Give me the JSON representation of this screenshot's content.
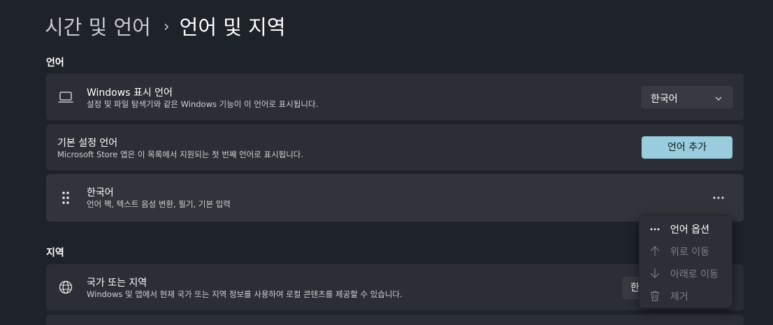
{
  "breadcrumb": {
    "parent": "시간 및 언어",
    "separator": "›",
    "current": "언어 및 지역"
  },
  "sections": {
    "language": "언어",
    "region": "지역"
  },
  "display_language": {
    "icon": "laptop-icon",
    "title": "Windows 표시 언어",
    "subtitle": "설정 및 파일 탐색기와 같은 Windows 기능이 이 언어로 표시됩니다.",
    "dropdown_value": "한국어"
  },
  "preferred_languages": {
    "title": "기본 설정 언어",
    "subtitle": "Microsoft Store 앱은 이 목록에서 지원되는 첫 번째 언어로 표시됩니다.",
    "add_button": "언어 추가"
  },
  "language_item": {
    "icon": "drag-handle-icon",
    "title": "한국어",
    "subtitle": "언어 팩, 텍스트 음성 변환, 필기, 기본 입력",
    "more": "···"
  },
  "country_region": {
    "icon": "globe-icon",
    "title": "국가 또는 지역",
    "subtitle": "Windows 및 앱에서 현재 국가 또는 지역 정보를 사용하여 로컬 콘텐츠를 제공할 수 있습니다.",
    "dropdown_value_partial": "한"
  },
  "context_menu": {
    "items": [
      {
        "label": "언어 옵션",
        "icon": "more-icon",
        "enabled": true
      },
      {
        "label": "위로 이동",
        "icon": "arrow-up-icon",
        "enabled": false
      },
      {
        "label": "아래로 이동",
        "icon": "arrow-down-icon",
        "enabled": false
      },
      {
        "label": "제거",
        "icon": "trash-icon",
        "enabled": false
      }
    ]
  },
  "colors": {
    "background": "#1e2329",
    "card": "#2b2f35",
    "accent": "#99ccdd"
  }
}
